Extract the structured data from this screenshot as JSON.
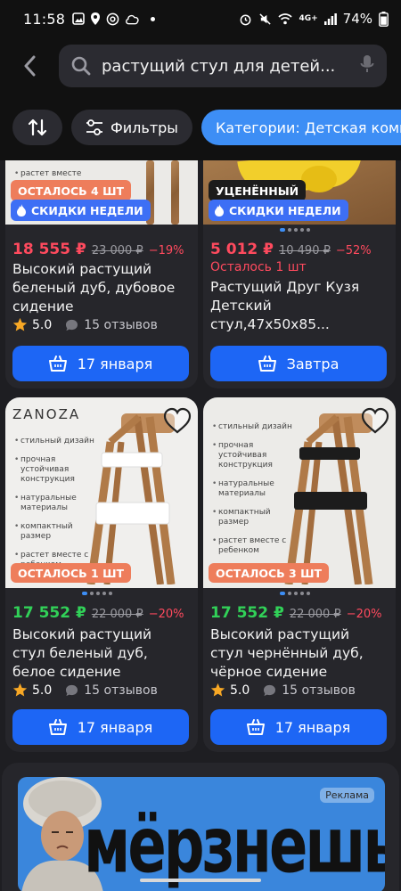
{
  "status_bar": {
    "time": "11:58",
    "battery": "74%",
    "network": "4G+"
  },
  "search": {
    "query": "растущий стул для детей...",
    "icons": [
      "back-arrow-icon",
      "search-icon",
      "mic-icon"
    ]
  },
  "filters": {
    "sort_icon": "sort-arrows-icon",
    "filters_label": "Фильтры",
    "category_label": "Категории: Детская комната"
  },
  "colors": {
    "accent_blue": "#1d66f5",
    "chip_blue": "#3d8ef5",
    "price_red": "#ff4a5e",
    "price_green": "#31d158",
    "badge_orange": "#ee7d5b"
  },
  "products": [
    {
      "badges": [
        "ОСТАЛОСЬ 4 ШТ",
        "СКИДКИ НЕДЕЛИ"
      ],
      "image_text": "растет вместе",
      "price": "18 555 ₽",
      "old_price": "23 000 ₽",
      "discount": "−19%",
      "title": "Высокий растущий беленый дуб, дубовое сидение",
      "rating": "5.0",
      "reviews": "15 отзывов",
      "delivery": "17 января"
    },
    {
      "badges": [
        "УЦЕНЁННЫЙ",
        "СКИДКИ НЕДЕЛИ"
      ],
      "price": "5 012 ₽",
      "old_price": "10 490 ₽",
      "discount": "−52%",
      "stock_note": "Осталось 1 шт",
      "title": "Растущий Друг Кузя Детский стул,47х50х85...",
      "delivery": "Завтра"
    },
    {
      "brand": "ZANOZA",
      "image_bullets": [
        "стильный дизайн",
        "прочная устойчивая конструкция",
        "натуральные материалы",
        "компактный размер",
        "растет вместе с ребенком"
      ],
      "badges": [
        "ОСТАЛОСЬ 1 ШТ"
      ],
      "price": "17 552 ₽",
      "old_price": "22 000 ₽",
      "discount": "−20%",
      "title": "Высокий растущий стул беленый дуб, белое сидение",
      "rating": "5.0",
      "reviews": "15 отзывов",
      "delivery": "17 января"
    },
    {
      "image_bullets": [
        "стильный дизайн",
        "прочная устойчивая конструкция",
        "натуральные материалы",
        "компактный размер",
        "растет вместе с ребенком"
      ],
      "badges": [
        "ОСТАЛОСЬ 3 ШТ"
      ],
      "price": "17 552 ₽",
      "old_price": "22 000 ₽",
      "discount": "−20%",
      "title": "Высокий растущий стул чернённый дуб, чёрное сидение",
      "rating": "5.0",
      "reviews": "15 отзывов",
      "delivery": "17 января"
    }
  ],
  "ad": {
    "label": "Реклама",
    "headline": "мёрзнешь?"
  }
}
